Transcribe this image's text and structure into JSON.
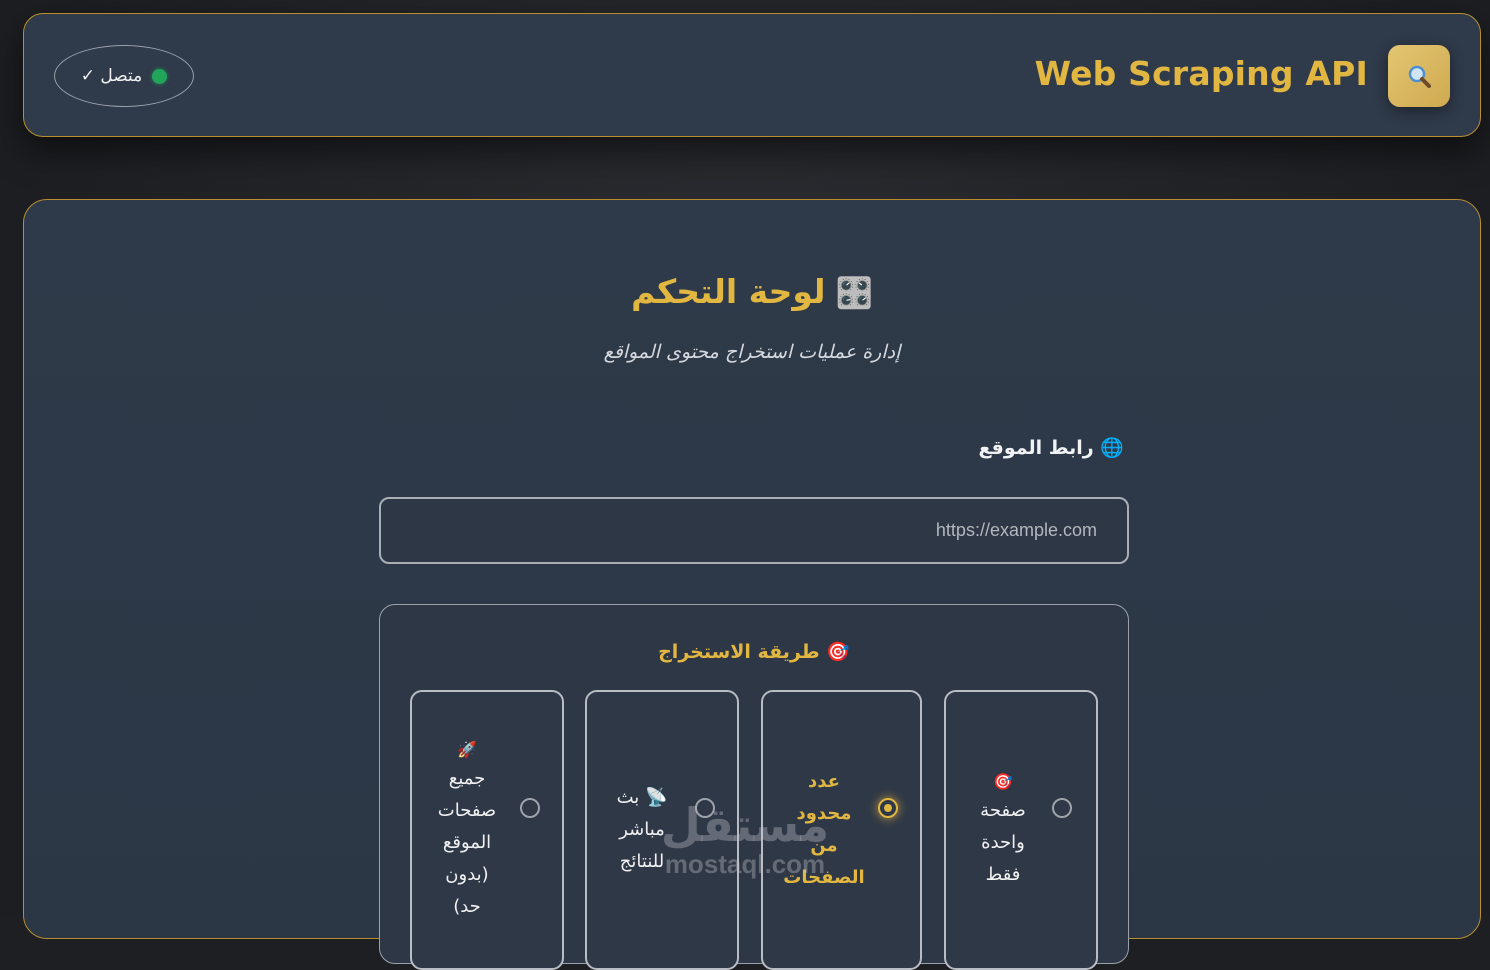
{
  "header": {
    "app_title": "Web Scraping API",
    "logo_icon": "magnifier-icon",
    "status": {
      "text": "متصل ✓",
      "dot_color": "#21a55a"
    }
  },
  "main": {
    "title_emoji": "🎛️",
    "title": "لوحة التحكم",
    "subtitle": "إدارة عمليات استخراج محتوى المواقع",
    "url_field": {
      "label_emoji": "🌐",
      "label": "رابط الموقع",
      "placeholder": "https://example.com",
      "value": ""
    },
    "method": {
      "title_emoji": "🎯",
      "title": "طريقة الاستخراج",
      "options": [
        {
          "emoji": "🎯",
          "lines": [
            "صفحة",
            "واحدة",
            "فقط"
          ],
          "selected": false
        },
        {
          "emoji": "",
          "lines": [
            "عدد",
            "محدود",
            "من",
            "الصفحات"
          ],
          "selected": true
        },
        {
          "emoji": "📡",
          "lines": [
            "بث",
            "مباشر",
            "للنتائج"
          ],
          "selected": false
        },
        {
          "emoji": "🚀",
          "lines": [
            "جميع",
            "صفحات",
            "الموقع",
            "(بدون",
            "حد)"
          ],
          "selected": false
        }
      ]
    }
  },
  "watermark": {
    "arabic": "مستقل",
    "latin": "mostaql.com"
  },
  "colors": {
    "accent": "#e2b741",
    "panel": "#2e3a49",
    "border_gold": "#b98f2e"
  }
}
